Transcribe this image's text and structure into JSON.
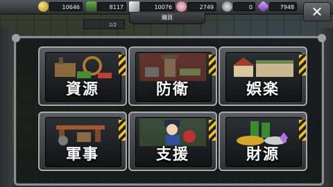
{
  "resources": [
    {
      "name": "gold",
      "icon": "gold-coin-icon",
      "value": "10646",
      "color": "#d4a72c"
    },
    {
      "name": "oil",
      "icon": "oil-barrel-icon",
      "value": "8117",
      "color": "#4f8a3a"
    },
    {
      "name": "steel",
      "icon": "steel-icon",
      "value": "10076",
      "color": "#c9ccd0"
    },
    {
      "name": "population",
      "icon": "population-icon",
      "value": "2749",
      "color": "#e8a0b0"
    },
    {
      "name": "medal",
      "icon": "medal-icon",
      "value": "0",
      "color": "#a0a4a8"
    },
    {
      "name": "crystal",
      "icon": "crystal-icon",
      "value": "7948",
      "color": "#b070e0"
    }
  ],
  "header": {
    "title": "購買",
    "sub_page": "2/2",
    "close_label": "✕"
  },
  "tiles": [
    {
      "label": "資源",
      "icon": "resources-icon",
      "art": "factory"
    },
    {
      "label": "防衛",
      "icon": "defense-icon",
      "art": "towers"
    },
    {
      "label": "娯楽",
      "icon": "entertainment-icon",
      "art": "buildings"
    },
    {
      "label": "軍事",
      "icon": "military-icon",
      "art": "base"
    },
    {
      "label": "支援",
      "icon": "support-icon",
      "art": "character"
    },
    {
      "label": "財源",
      "icon": "finance-icon",
      "art": "treasure"
    }
  ]
}
